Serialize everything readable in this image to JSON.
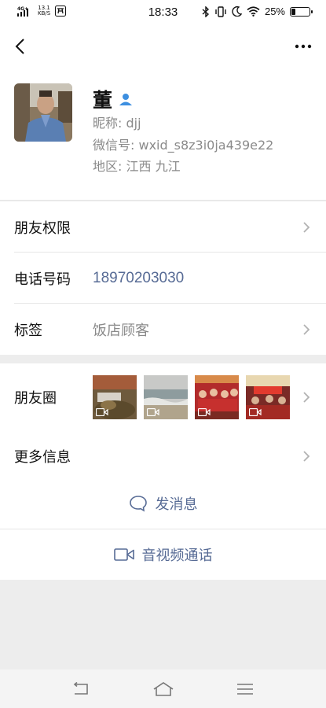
{
  "status_bar": {
    "network": "4G+",
    "speed_value": "13.1",
    "speed_unit": "KB/S",
    "time": "18:33",
    "battery_percent": "25%",
    "battery_level": 0.25
  },
  "profile": {
    "name": "董",
    "nickname": "昵称: djj",
    "wechat_id": "微信号: wxid_s8z3i0ja439e22",
    "region": "地区: 江西  九江"
  },
  "rows": {
    "friend_permissions": "朋友权限",
    "phone_label": "电话号码",
    "phone_value": "18970203030",
    "tags_label": "标签",
    "tags_value": "饭店顾客",
    "moments_label": "朋友圈",
    "more_info": "更多信息"
  },
  "actions": {
    "send_message": "发消息",
    "av_call": "音视频通话"
  },
  "colors": {
    "link_blue": "#576b95",
    "label_gray": "#8a8a8a",
    "page_bg": "#ededed"
  }
}
